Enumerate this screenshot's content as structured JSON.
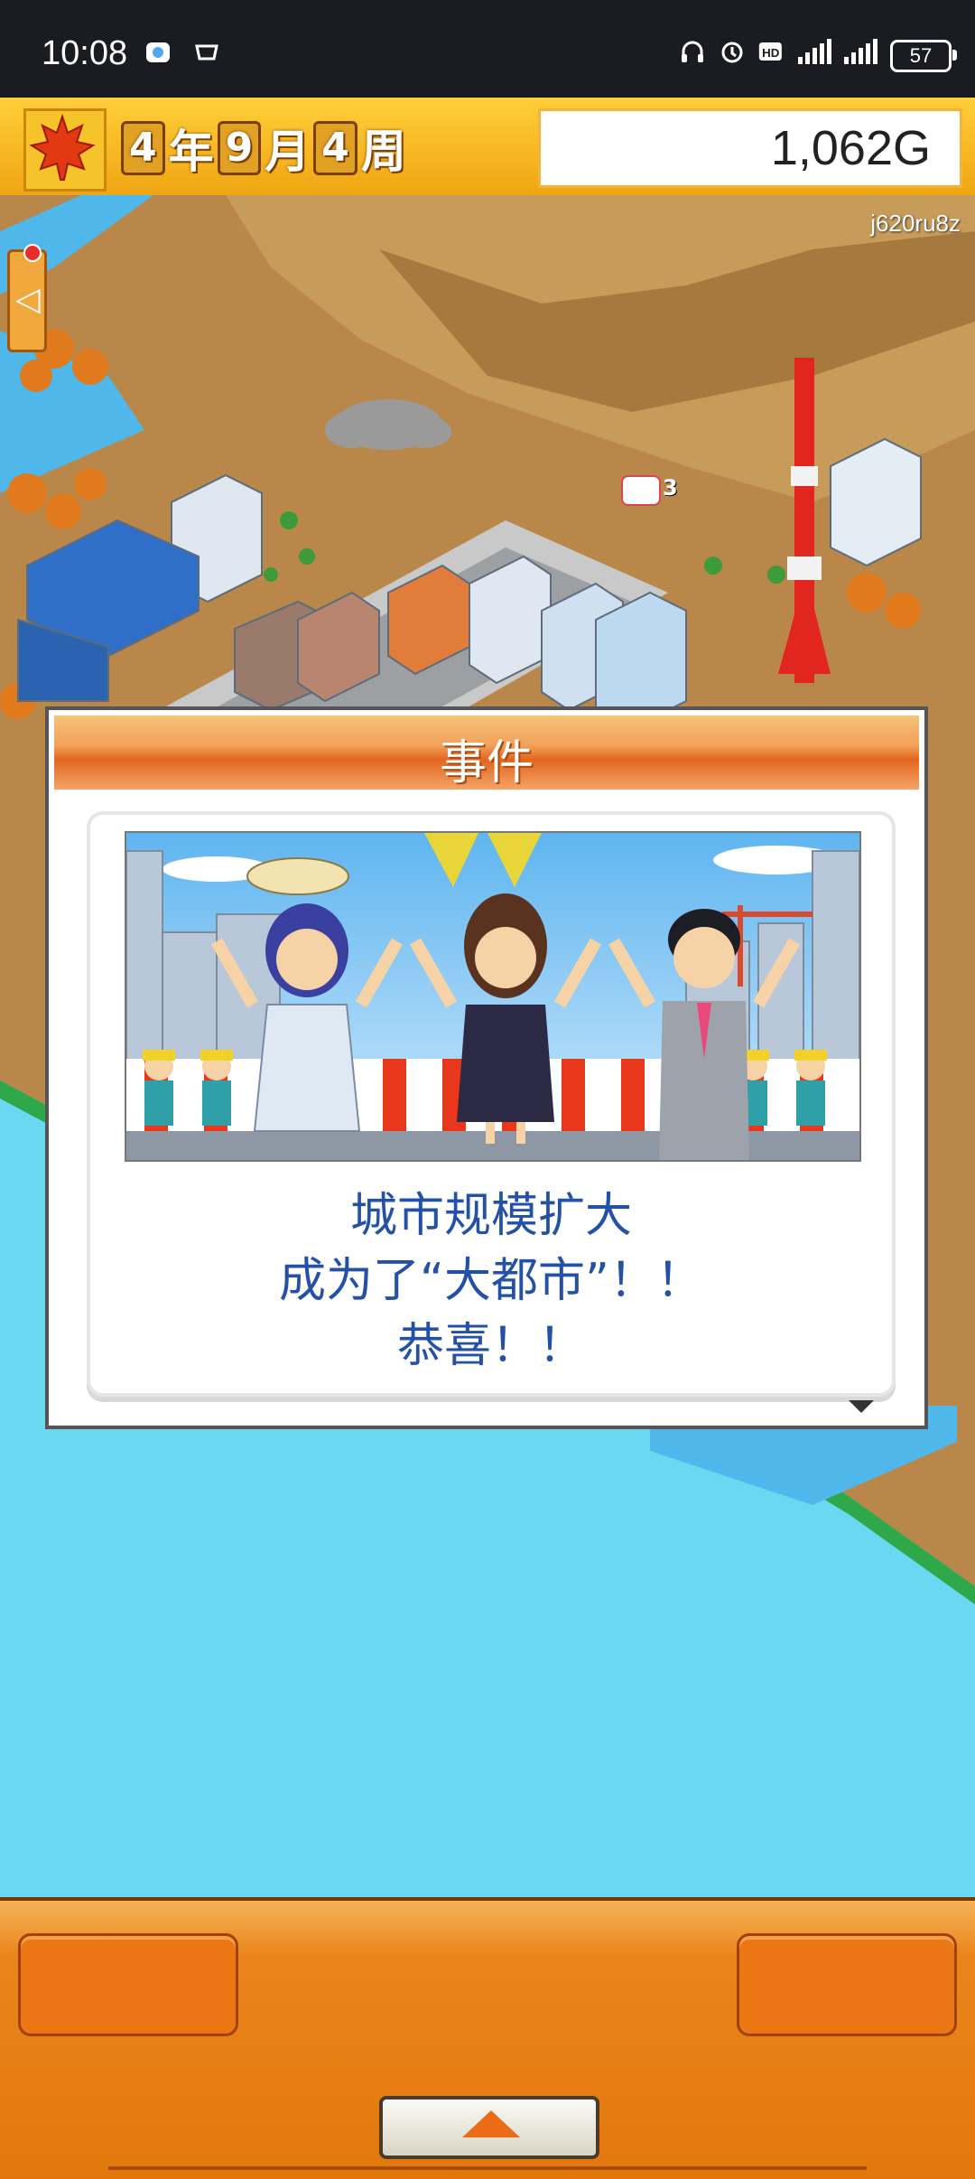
{
  "status_bar": {
    "time": "10:08",
    "left_icons": [
      "chat-app-icon",
      "cup-icon"
    ],
    "right_icons": [
      "headphones-icon",
      "alarm-icon",
      "hd-icon",
      "signal-5g-icon",
      "signal-4g-icon"
    ],
    "battery": "57"
  },
  "top_bar": {
    "season_icon": "maple-leaf-icon",
    "date": {
      "year": "4",
      "year_unit": "年",
      "month": "9",
      "month_unit": "月",
      "week": "4",
      "week_unit": "周"
    },
    "money": "1,062G"
  },
  "map": {
    "watermark": "j620ru8z",
    "side_tab_icon": "chevron-left-icon",
    "badge": "3"
  },
  "event_dialog": {
    "title": "事件",
    "message_lines": [
      "城市规模扩大",
      "成为了“大都市”！！",
      "恭喜！！"
    ],
    "next_icon": "triangle-down-icon"
  },
  "bottom_bar": {
    "toggle_icon": "triangle-up-icon"
  },
  "colors": {
    "sea": "#6ad8f1",
    "dialog_text": "#2451a8",
    "menu_orange": "#ea851b"
  }
}
